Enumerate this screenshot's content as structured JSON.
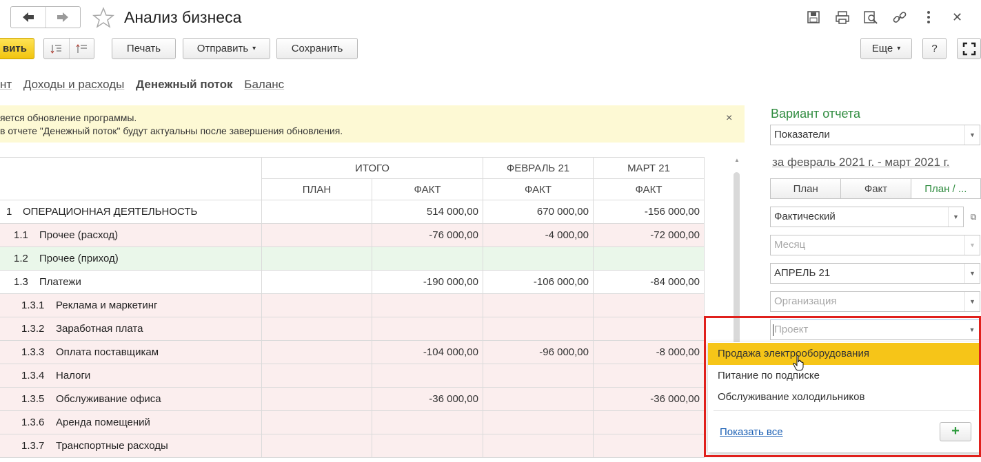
{
  "window": {
    "title": "Анализ бизнеса"
  },
  "toolbar": {
    "primary_label": "вить",
    "print_label": "Печать",
    "send_label": "Отправить",
    "save_label": "Сохранить",
    "more_label": "Еще",
    "help_label": "?"
  },
  "tabs": [
    {
      "label": "нт"
    },
    {
      "label": "Доходы и расходы"
    },
    {
      "label": "Денежный поток"
    },
    {
      "label": "Баланс"
    }
  ],
  "notice": {
    "line1": "яется обновление программы.",
    "line2": " в отчете \"Денежный поток\" будут актуальны после завершения обновления.",
    "close": "×"
  },
  "table": {
    "groups": {
      "total": "ИТОГО",
      "feb": "ФЕВРАЛЬ 21",
      "mar": "МАРТ 21"
    },
    "sub": {
      "plan": "ПЛАН",
      "fact1": "ФАКТ",
      "fact2": "ФАКТ",
      "fact3": "ФАКТ"
    },
    "rows": [
      {
        "code": "1",
        "name": "ОПЕРАЦИОННАЯ ДЕЯТЕЛЬНОСТЬ",
        "plan": "",
        "fact": "514 000,00",
        "feb": "670 000,00",
        "mar": "-156 000,00"
      },
      {
        "code": "1.1",
        "name": "Прочее (расход)",
        "plan": "",
        "fact": "-76 000,00",
        "feb": "-4 000,00",
        "mar": "-72 000,00"
      },
      {
        "code": "1.2",
        "name": "Прочее (приход)",
        "plan": "",
        "fact": "",
        "feb": "",
        "mar": ""
      },
      {
        "code": "1.3",
        "name": "Платежи",
        "plan": "",
        "fact": "-190 000,00",
        "feb": "-106 000,00",
        "mar": "-84 000,00"
      },
      {
        "code": "1.3.1",
        "name": "Реклама и маркетинг",
        "plan": "",
        "fact": "",
        "feb": "",
        "mar": ""
      },
      {
        "code": "1.3.2",
        "name": "Заработная плата",
        "plan": "",
        "fact": "",
        "feb": "",
        "mar": ""
      },
      {
        "code": "1.3.3",
        "name": "Оплата поставщикам",
        "plan": "",
        "fact": "-104 000,00",
        "feb": "-96 000,00",
        "mar": "-8 000,00"
      },
      {
        "code": "1.3.4",
        "name": "Налоги",
        "plan": "",
        "fact": "",
        "feb": "",
        "mar": ""
      },
      {
        "code": "1.3.5",
        "name": "Обслуживание офиса",
        "plan": "",
        "fact": "-36 000,00",
        "feb": "",
        "mar": "-36 000,00"
      },
      {
        "code": "1.3.6",
        "name": "Аренда помещений",
        "plan": "",
        "fact": "",
        "feb": "",
        "mar": ""
      },
      {
        "code": "1.3.7",
        "name": "Транспортные расходы",
        "plan": "",
        "fact": "",
        "feb": "",
        "mar": ""
      }
    ]
  },
  "panel": {
    "title": "Вариант отчета",
    "variant": "Показатели",
    "period": "за февраль 2021 г. - март 2021 г.",
    "seg": [
      "План",
      "Факт",
      "План / ..."
    ],
    "scenario": "Фактический",
    "periodicity_placeholder": "Месяц",
    "month": "АПРЕЛЬ 21",
    "org_placeholder": "Организация",
    "project_placeholder": "Проект"
  },
  "dropdown": {
    "items": [
      "Продажа электрооборудования",
      "Питание по подписке",
      "Обслуживание холодильников"
    ],
    "show_all": "Показать все",
    "add": "+"
  },
  "colors": {
    "accent_green": "#2e8b3e",
    "highlight_yellow": "#f6c518",
    "notice_bg": "#fdf9d4",
    "row_pink": "#fbeeee",
    "row_green": "#eaf7ea",
    "annotation_red": "#e0201c"
  },
  "icons": {
    "back": "arrow-left-icon",
    "forward": "arrow-right-icon",
    "favorite": "star-icon",
    "save": "floppy-icon",
    "print": "printer-icon",
    "preview": "preview-icon",
    "link": "link-icon",
    "close": "close-icon",
    "fullscreen": "fullscreen-icon"
  }
}
